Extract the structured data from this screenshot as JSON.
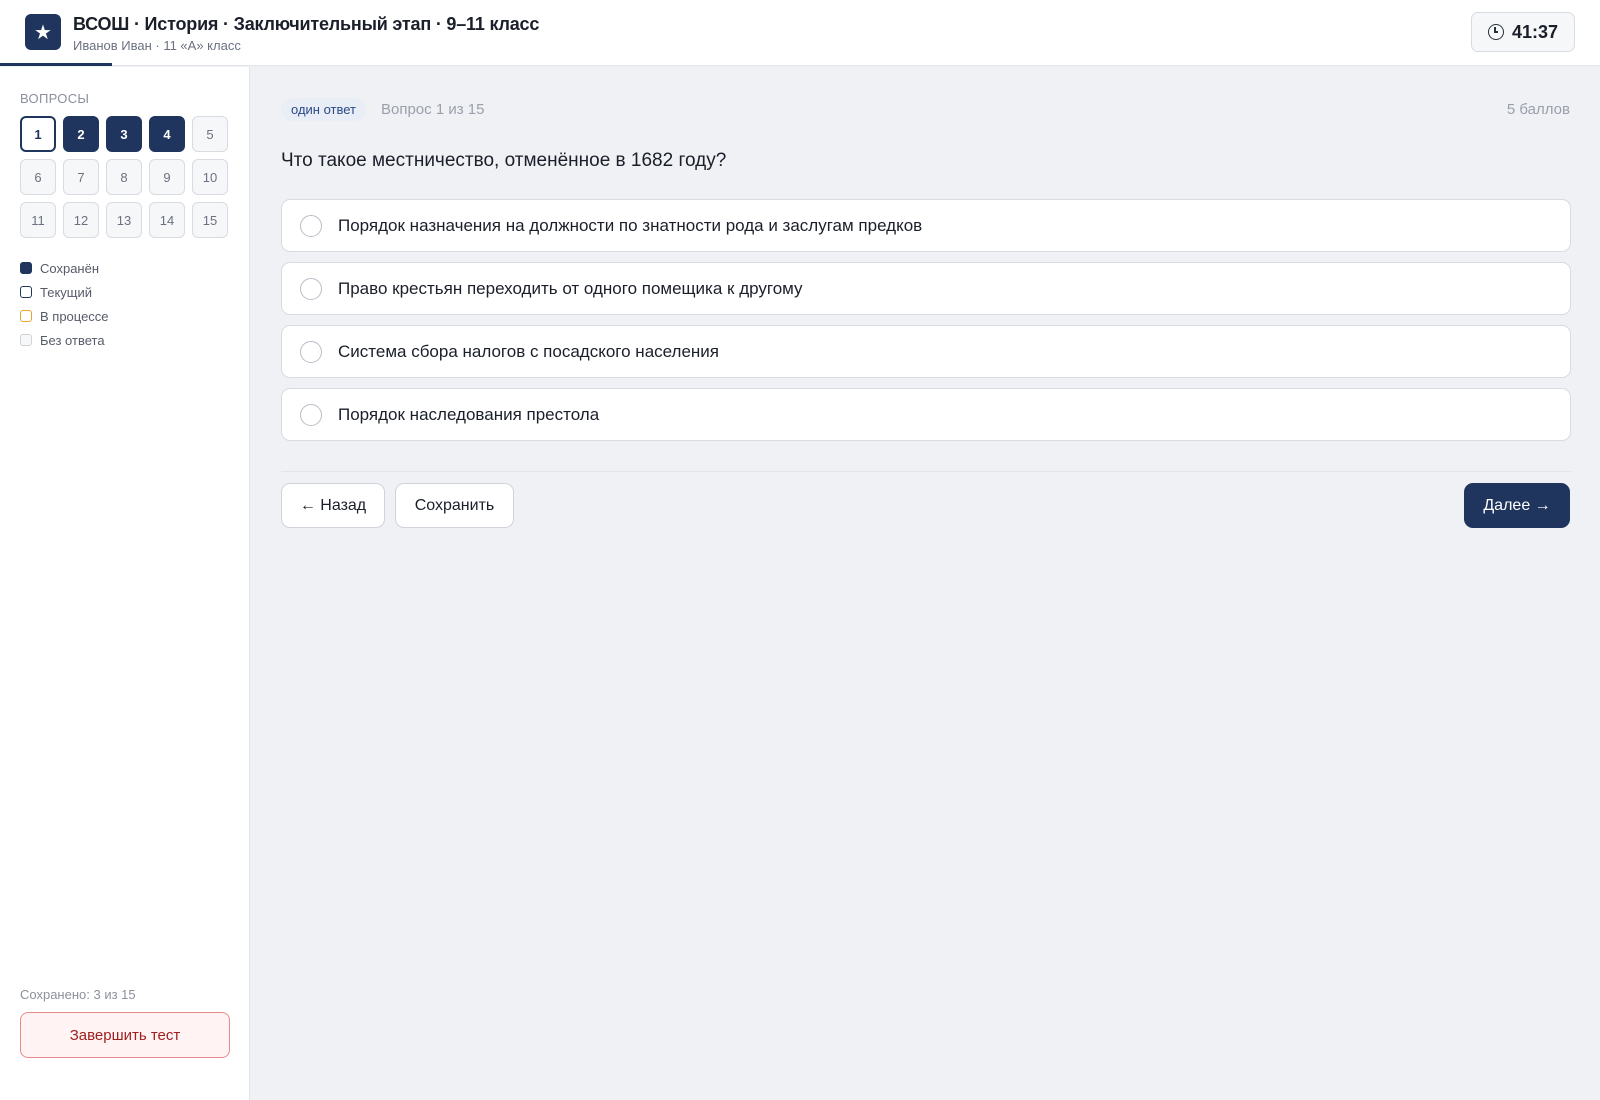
{
  "header": {
    "logo_icon": "★",
    "title": "ВСОШ · История · Заключительный этап · 9–11 класс",
    "subtitle": "Иванов Иван · 11 «А» класс",
    "timer": "41:37",
    "progress_fraction": 0.07
  },
  "sidebar": {
    "heading": "ВОПРОСЫ",
    "questions": [
      {
        "label": "1",
        "state": "current"
      },
      {
        "label": "2",
        "state": "saved"
      },
      {
        "label": "3",
        "state": "saved"
      },
      {
        "label": "4",
        "state": "saved"
      },
      {
        "label": "5",
        "state": "empty"
      },
      {
        "label": "6",
        "state": "empty"
      },
      {
        "label": "7",
        "state": "empty"
      },
      {
        "label": "8",
        "state": "empty"
      },
      {
        "label": "9",
        "state": "empty"
      },
      {
        "label": "10",
        "state": "empty"
      },
      {
        "label": "11",
        "state": "empty"
      },
      {
        "label": "12",
        "state": "empty"
      },
      {
        "label": "13",
        "state": "empty"
      },
      {
        "label": "14",
        "state": "empty"
      },
      {
        "label": "15",
        "state": "empty"
      }
    ],
    "legend": [
      {
        "label": "Сохранён",
        "fill": "#1f355e",
        "border": "#1f355e"
      },
      {
        "label": "Текущий",
        "fill": "#ffffff",
        "border": "#1f355e"
      },
      {
        "label": "В процессе",
        "fill": "#ffffff",
        "border": "#e6a52a"
      },
      {
        "label": "Без ответа",
        "fill": "#f6f7f9",
        "border": "#d0d3da"
      }
    ],
    "saved_count": "Сохранено: 3 из 15",
    "finish_label": "Завершить тест"
  },
  "main": {
    "badge": "один ответ",
    "question_number": "Вопрос 1 из 15",
    "points": "5 баллов",
    "question": "Что такое местничество, отменённое в 1682 году?",
    "options": [
      "Порядок назначения на должности по знатности рода и заслугам предков",
      "Право крестьян переходить от одного помещика к другому",
      "Система сбора налогов с посадского населения",
      "Порядок наследования престола"
    ],
    "back_label": "← Назад",
    "save_label": "Сохранить",
    "next_label": "Далее →"
  },
  "colors": {
    "accent": "#1f355e",
    "danger": "#a01f1f"
  }
}
